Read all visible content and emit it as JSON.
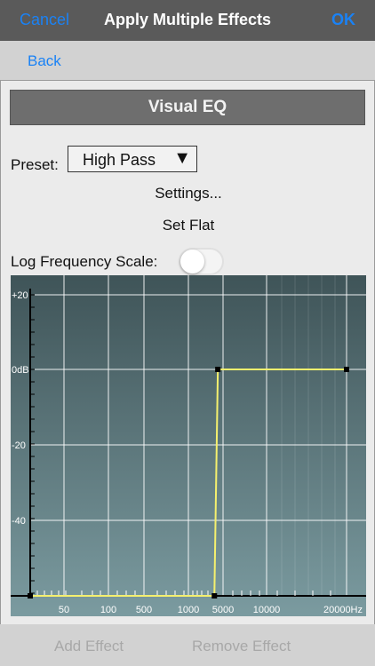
{
  "navbar": {
    "cancel_label": "Cancel",
    "title": "Apply Multiple Effects",
    "ok_label": "OK"
  },
  "back_label": "Back",
  "effect": {
    "name": "Visual EQ",
    "preset_label": "Preset:",
    "preset_value": "High Pass",
    "preset_arrow": "▼",
    "settings_label": "Settings...",
    "set_flat_label": "Set Flat",
    "log_scale_label": "Log Frequency Scale:",
    "log_scale_on": false
  },
  "graph": {
    "db_labels": [
      "+20",
      "0dB",
      "-20",
      "-40"
    ],
    "freq_labels": [
      "50",
      "100",
      "500",
      "1000",
      "5000",
      "10000",
      "20000Hz"
    ],
    "curve": [
      [
        0,
        -60
      ],
      [
        4000,
        -60
      ],
      [
        4400,
        0
      ],
      [
        20000,
        0
      ]
    ],
    "colors": {
      "bg_top": "#3f5458",
      "bg_bottom": "#7b9ba0",
      "grid": "#ffffff",
      "curve": "#f5f06e",
      "axis": "#000000"
    }
  },
  "bottom": {
    "add_effect_label": "Add Effect",
    "remove_effect_label": "Remove Effect"
  }
}
